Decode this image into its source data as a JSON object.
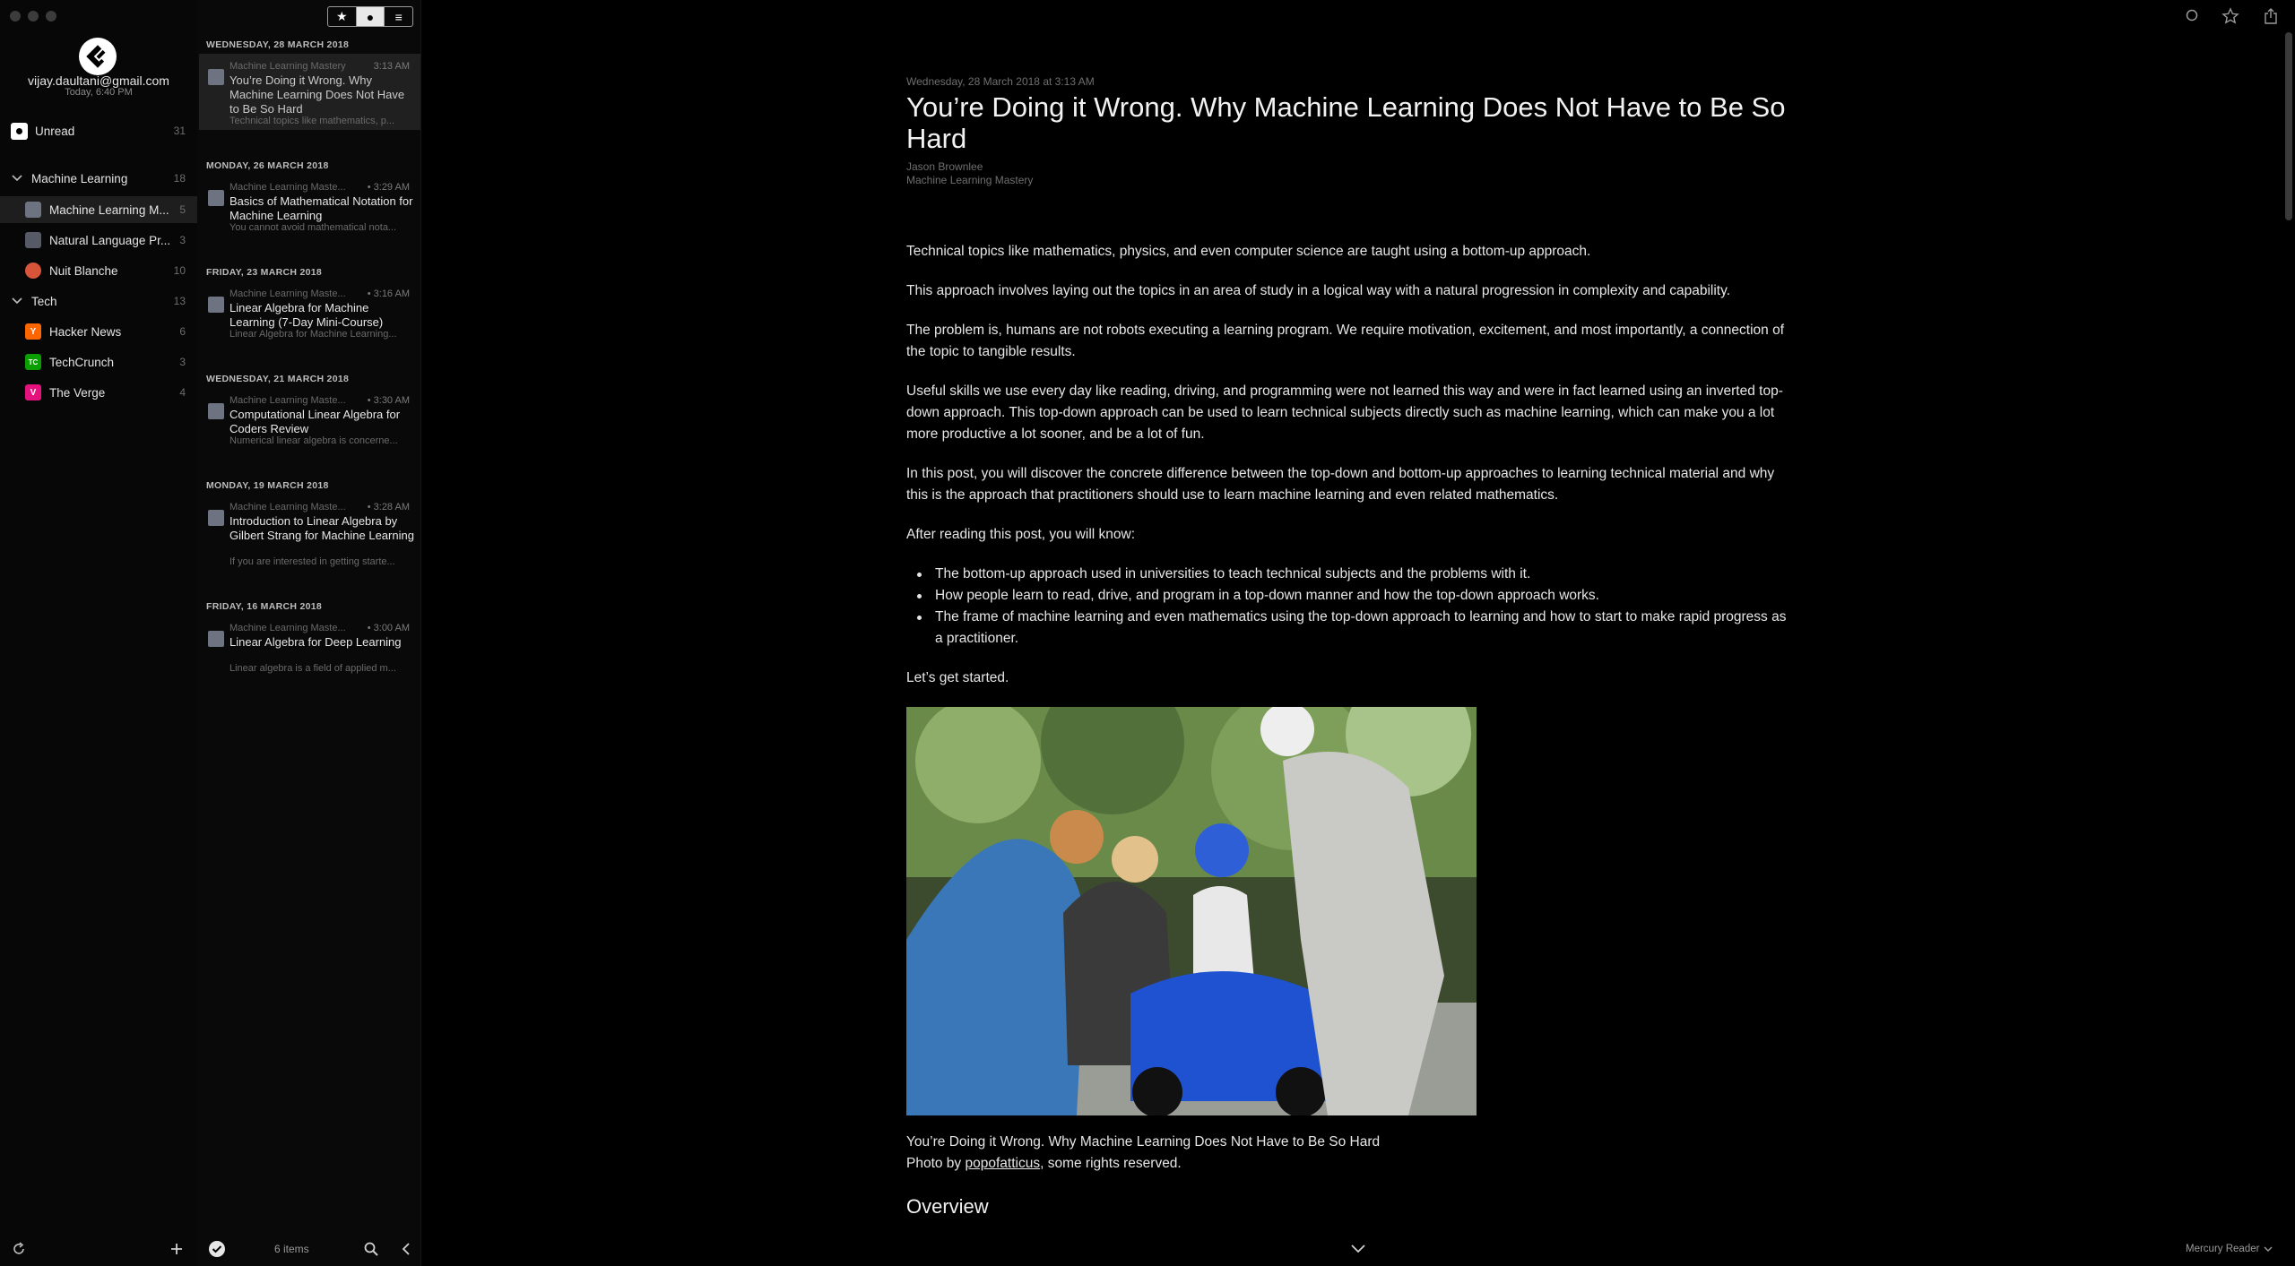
{
  "account": {
    "email": "vijay.daultani@gmail.com",
    "last_sync": "Today, 6:40 PM"
  },
  "sidebar": {
    "unread": {
      "label": "Unread",
      "count": "31"
    },
    "groups": [
      {
        "label": "Machine Learning",
        "count": "18",
        "feeds": [
          {
            "label": "Machine Learning M...",
            "count": "5",
            "color": "#6d7380",
            "icon": "ml-mastery-favicon"
          },
          {
            "label": "Natural Language Pr...",
            "count": "3",
            "color": "#555a66",
            "icon": "nlp-favicon"
          },
          {
            "label": "Nuit Blanche",
            "count": "10",
            "color": "#d8553a",
            "icon": "nuit-blanche-favicon"
          }
        ]
      },
      {
        "label": "Tech",
        "count": "13",
        "feeds": [
          {
            "label": "Hacker News",
            "count": "6",
            "color": "#ff6600",
            "icon": "Y"
          },
          {
            "label": "TechCrunch",
            "count": "3",
            "color": "#0a9e01",
            "icon": "TC"
          },
          {
            "label": "The Verge",
            "count": "4",
            "color": "#e5127d",
            "icon": "V"
          }
        ]
      }
    ]
  },
  "toolbar": {
    "filter_star": "★",
    "filter_unread": "●",
    "filter_all": "≡"
  },
  "list": {
    "groups": [
      {
        "date": "WEDNESDAY, 28 MARCH 2018",
        "entries": [
          {
            "source": "Machine Learning Mastery",
            "time": "3:13 AM",
            "title": "You’re Doing it Wrong. Why Machine Learning Does Not Have to Be So Hard",
            "snippet": "Technical topics like mathematics, p..."
          }
        ]
      },
      {
        "date": "MONDAY, 26 MARCH 2018",
        "entries": [
          {
            "source": "Machine Learning Maste...",
            "time": "• 3:29 AM",
            "title": "Basics of Mathematical Notation for Machine Learning",
            "snippet": "You cannot avoid mathematical nota..."
          }
        ]
      },
      {
        "date": "FRIDAY, 23 MARCH 2018",
        "entries": [
          {
            "source": "Machine Learning Maste...",
            "time": "• 3:16 AM",
            "title": "Linear Algebra for Machine Learning (7-Day Mini-Course)",
            "snippet": "Linear Algebra for Machine Learning..."
          }
        ]
      },
      {
        "date": "WEDNESDAY, 21 MARCH 2018",
        "entries": [
          {
            "source": "Machine Learning Maste...",
            "time": "• 3:30 AM",
            "title": "Computational Linear Algebra for Coders Review",
            "snippet": "Numerical linear algebra is concerne..."
          }
        ]
      },
      {
        "date": "MONDAY, 19 MARCH 2018",
        "entries": [
          {
            "source": "Machine Learning Maste...",
            "time": "• 3:28 AM",
            "title": "Introduction to Linear Algebra by Gilbert Strang for Machine Learning",
            "snippet": "If you are interested in getting starte..."
          }
        ]
      },
      {
        "date": "FRIDAY, 16 MARCH 2018",
        "entries": [
          {
            "source": "Machine Learning Maste...",
            "time": "• 3:00 AM",
            "title": "Linear Algebra for Deep Learning",
            "snippet": "Linear algebra is a field of applied m..."
          }
        ]
      }
    ],
    "count_label": "6 items"
  },
  "article": {
    "date": "Wednesday, 28 March 2018 at 3:13 AM",
    "title": "You’re Doing it Wrong. Why Machine Learning Does Not Have to Be So Hard",
    "author": "Jason Brownlee",
    "feed": "Machine Learning Mastery",
    "paragraphs": [
      "Technical topics like mathematics, physics, and even computer science are taught using a bottom-up approach.",
      "This approach involves laying out the topics in an area of study in a logical way with a natural progression in complexity and capability.",
      "The problem is, humans are not robots executing a learning program. We require motivation, excitement, and most importantly, a connection of the topic to tangible results.",
      "Useful skills we use every day like reading, driving, and programming were not learned this way and were in fact learned using an inverted top-down approach. This top-down approach can be used to learn technical subjects directly such as machine learning, which can make you a lot more productive a lot sooner, and be a lot of fun.",
      "In this post, you will discover the concrete difference between the top-down and bottom-up approaches to learning technical material and why this is the approach that practitioners should use to learn machine learning and even related mathematics.",
      "After reading this post, you will know:"
    ],
    "bullets": [
      "The bottom-up approach used in universities to teach technical subjects and the problems with it.",
      "How people learn to read, drive, and program in a top-down manner and how the top-down approach works.",
      "The frame of machine learning and even mathematics using the top-down approach to learning and how to start to make rapid progress as a practitioner."
    ],
    "after_bullets": "Let’s get started.",
    "caption_line1": "You’re Doing it Wrong. Why Machine Learning Does Not Have to Be So Hard",
    "caption_prefix": "Photo by ",
    "caption_link": "popofatticus",
    "caption_suffix": ", some rights reserved.",
    "heading": "Overview"
  },
  "footer": {
    "theme_label": "Mercury Reader"
  }
}
